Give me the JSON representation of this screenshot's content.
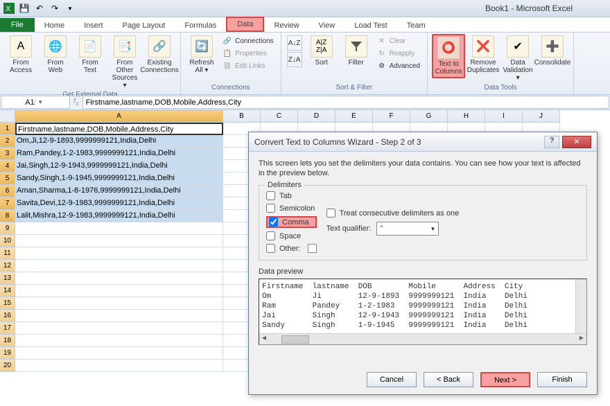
{
  "title": "Book1 - Microsoft Excel",
  "tabs": {
    "file": "File",
    "home": "Home",
    "insert": "Insert",
    "page_layout": "Page Layout",
    "formulas": "Formulas",
    "data": "Data",
    "review": "Review",
    "view": "View",
    "load_test": "Load Test",
    "team": "Team"
  },
  "ribbon": {
    "get_external_data": {
      "label": "Get External Data",
      "from_access": "From Access",
      "from_web": "From Web",
      "from_text": "From Text",
      "from_other": "From Other Sources ▾",
      "existing": "Existing Connections"
    },
    "connections": {
      "label": "Connections",
      "refresh": "Refresh All ▾",
      "connections": "Connections",
      "properties": "Properties",
      "edit_links": "Edit Links"
    },
    "sort_filter": {
      "label": "Sort & Filter",
      "sort": "Sort",
      "filter": "Filter",
      "clear": "Clear",
      "reapply": "Reapply",
      "advanced": "Advanced"
    },
    "data_tools": {
      "label": "Data Tools",
      "text_to_columns": "Text to Columns",
      "remove_duplicates": "Remove Duplicates",
      "data_validation": "Data Validation ▾",
      "consolidate": "Consolidate"
    }
  },
  "namebox": "A1",
  "formula": "Firstname,lastname,DOB,Mobile,Address,City",
  "columns": [
    "A",
    "B",
    "C",
    "D",
    "E",
    "F",
    "G",
    "H",
    "I",
    "J"
  ],
  "col_widths": {
    "A": 300
  },
  "rows": [
    1,
    2,
    3,
    4,
    5,
    6,
    7,
    8,
    9,
    10,
    11,
    12,
    13,
    14,
    15,
    16,
    17,
    18,
    19,
    20
  ],
  "cells": {
    "1": "Firstname,lastname,DOB,Mobile,Address,City",
    "2": "Om,Ji,12-9-1893,9999999121,India,Delhi",
    "3": "Ram,Pandey,1-2-1983,9999999121,India,Delhi",
    "4": "Jai,Singh,12-9-1943,9999999121,India,Delhi",
    "5": "Sandy,Singh,1-9-1945,9999999121,India,Delhi",
    "6": "Aman,Sharma,1-8-1976,9999999121,India,Delhi",
    "7": "Savita,Devi,12-9-1983,9999999121,India,Delhi",
    "8": "Lalit,Mishra,12-9-1983,9999999121,India,Delhi"
  },
  "dialog": {
    "title": "Convert Text to Columns Wizard - Step 2 of 3",
    "desc": "This screen lets you set the delimiters your data contains.  You can see how your text is affected in the preview below.",
    "delimiters_label": "Delimiters",
    "tab": "Tab",
    "semicolon": "Semicolon",
    "comma": "Comma",
    "space": "Space",
    "other": "Other:",
    "treat_consecutive": "Treat consecutive delimiters as one",
    "text_qualifier_label": "Text qualifier:",
    "text_qualifier_value": "\"",
    "preview_label": "Data preview",
    "preview_rows": [
      [
        "Firstname",
        "lastname",
        "DOB",
        "Mobile",
        "Address",
        "City"
      ],
      [
        "Om",
        "Ji",
        "12-9-1893",
        "9999999121",
        "India",
        "Delhi"
      ],
      [
        "Ram",
        "Pandey",
        "1-2-1983",
        "9999999121",
        "India",
        "Delhi"
      ],
      [
        "Jai",
        "Singh",
        "12-9-1943",
        "9999999121",
        "India",
        "Delhi"
      ],
      [
        "Sandy",
        "Singh",
        "1-9-1945",
        "9999999121",
        "India",
        "Delhi"
      ]
    ],
    "buttons": {
      "cancel": "Cancel",
      "back": "< Back",
      "next": "Next >",
      "finish": "Finish"
    }
  }
}
